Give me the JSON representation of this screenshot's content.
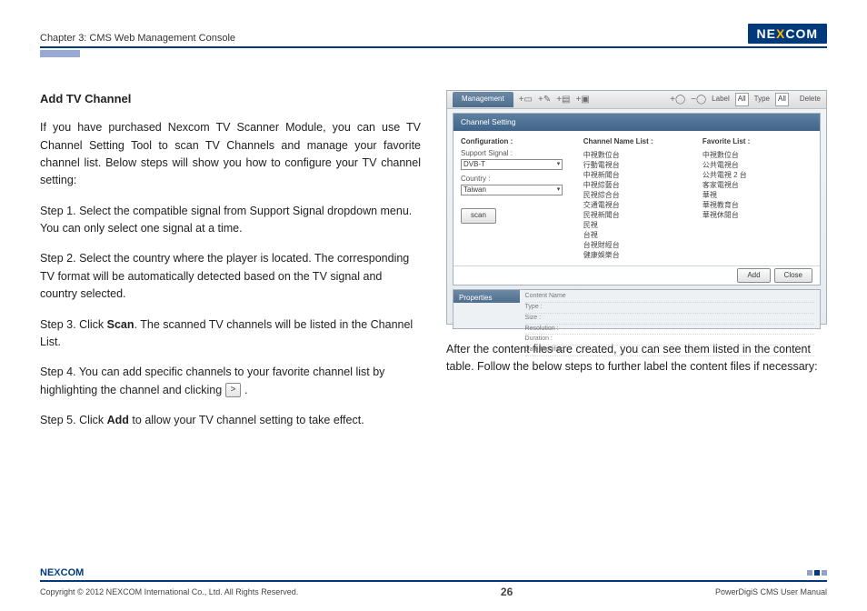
{
  "header": {
    "chapter": "Chapter 3: CMS Web Management Console",
    "brand_pre": "NE",
    "brand_x": "X",
    "brand_post": "COM"
  },
  "left": {
    "title": "Add TV Channel",
    "intro": "If you have purchased Nexcom TV Scanner Module, you can use TV Channel Setting Tool to scan TV Channels and manage your favorite channel list. Below steps will show you how to configure your TV channel setting:",
    "step1": "Step 1. Select the compatible signal from Support Signal dropdown menu. You can only select one signal at a time.",
    "step2": "Step 2. Select the country where the player is located. The corresponding TV format will be automatically detected based on the TV signal and country selected.",
    "step3a": "Step 3. Click ",
    "step3_bold": "Scan",
    "step3b": ". The scanned TV channels will be listed in the Channel List.",
    "step4a": "Step 4. You can add specific channels to your favorite channel list by highlighting the channel and clicking ",
    "step4_btn": ">",
    "step4b": " .",
    "step5a": "Step 5. Click ",
    "step5_bold": "Add",
    "step5b": " to allow your TV channel setting to take effect."
  },
  "shot": {
    "tab": "Management",
    "icons": [
      "+▭",
      "+✎",
      "+▤",
      "+▣"
    ],
    "icons2_minus": "−◯",
    "icons2_plus": "+◯",
    "label_label": "Label",
    "label_all": "All",
    "type_label": "Type",
    "type_all": "All",
    "delete": "Delete",
    "panel_title": "Channel Setting",
    "cfg_title": "Configuration :",
    "support_label": "Support Signal :",
    "support_value": "DVB-T",
    "country_label": "Country :",
    "country_value": "Taiwan",
    "scan": "scan",
    "name_title": "Channel Name List :",
    "fav_title": "Favorite List :",
    "names": [
      "中視數位台",
      "行動電視台",
      "中視新聞台",
      "中視綜藝台",
      "民視綜合台",
      "交通電視台",
      "民視新聞台",
      "民視",
      "台視",
      "台視財經台",
      "健康娛樂台"
    ],
    "favs": [
      "中視數位台",
      "公共電視台",
      "公共電視 2 台",
      "客家電視台",
      "華視",
      "華視教育台",
      "華視休閒台"
    ],
    "add": "Add",
    "close": "Close",
    "props": "Properties",
    "prop_rows": [
      "Content Name",
      "Type :",
      "Size :",
      "Resolution :",
      "Duration :",
      "Date Modified :"
    ]
  },
  "right": {
    "after": "After the content files are created, you can see them listed in the content table. Follow the below steps to further label the content files if necessary:"
  },
  "footer": {
    "copyright": "Copyright © 2012 NEXCOM International Co., Ltd. All Rights Reserved.",
    "page": "26",
    "manual": "PowerDigiS CMS User Manual",
    "brand_pre": "NE",
    "brand_x": "X",
    "brand_post": "COM"
  }
}
